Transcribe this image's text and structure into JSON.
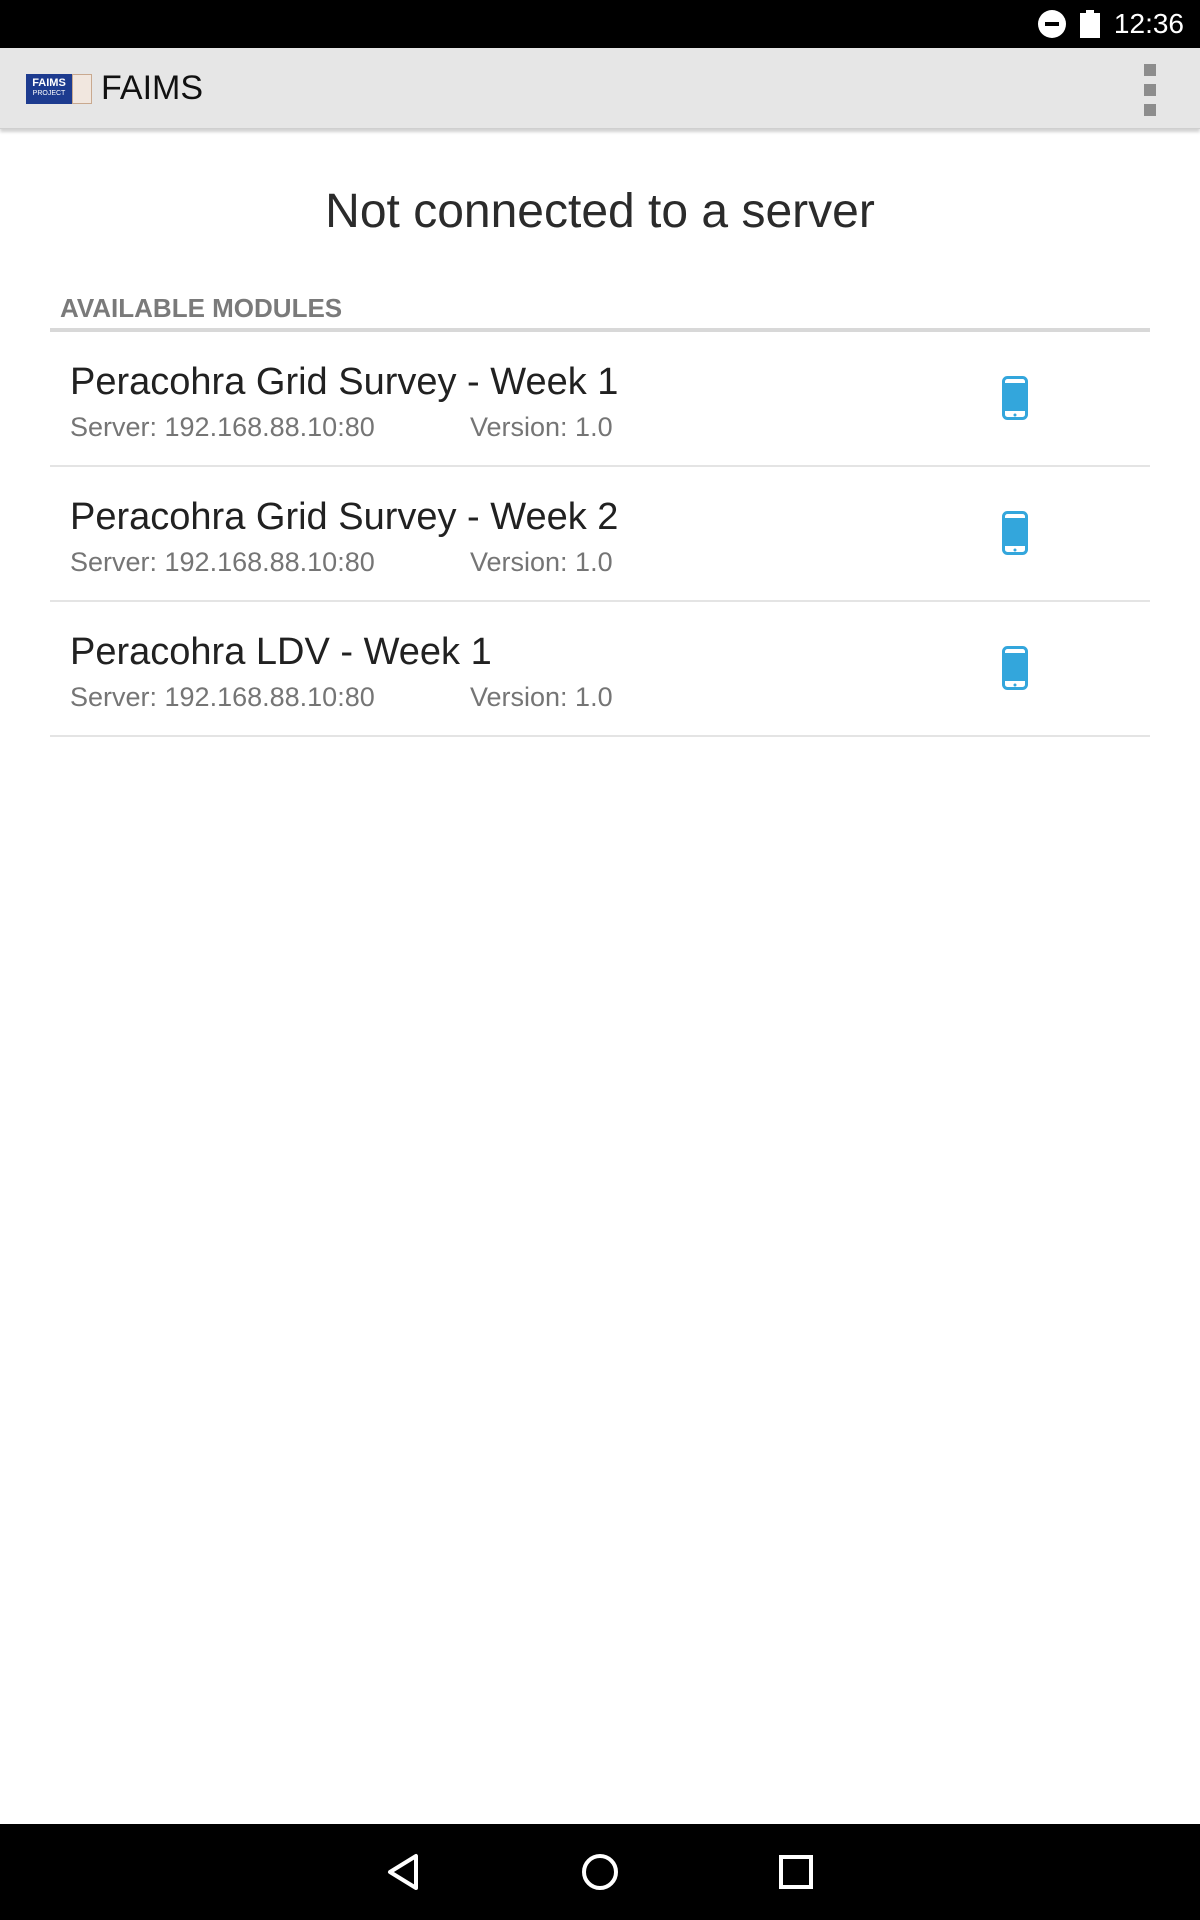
{
  "status_bar": {
    "time": "12:36",
    "icons": [
      "do-not-disturb-icon",
      "battery-icon"
    ]
  },
  "action_bar": {
    "logo_text": "FAIMS",
    "logo_subtext": "PROJECT",
    "title": "FAIMS",
    "overflow_icon": "overflow-menu-icon"
  },
  "main": {
    "connection_status": "Not connected to a server",
    "section_title": "AVAILABLE MODULES",
    "modules": [
      {
        "name": "Peracohra Grid Survey - Week 1",
        "server": "Server: 192.168.88.10:80",
        "version": "Version: 1.0",
        "icon": "phone-icon"
      },
      {
        "name": "Peracohra Grid Survey - Week 2",
        "server": "Server: 192.168.88.10:80",
        "version": "Version: 1.0",
        "icon": "phone-icon"
      },
      {
        "name": "Peracohra LDV - Week 1",
        "server": "Server: 192.168.88.10:80",
        "version": "Version: 1.0",
        "icon": "phone-icon"
      }
    ]
  },
  "nav_bar": {
    "buttons": [
      "back-icon",
      "home-icon",
      "recents-icon"
    ]
  },
  "colors": {
    "accent": "#33a6dc",
    "action_bar_bg": "#e6e6e6",
    "section_title": "#7a7a7a",
    "secondary_text": "#757575"
  }
}
